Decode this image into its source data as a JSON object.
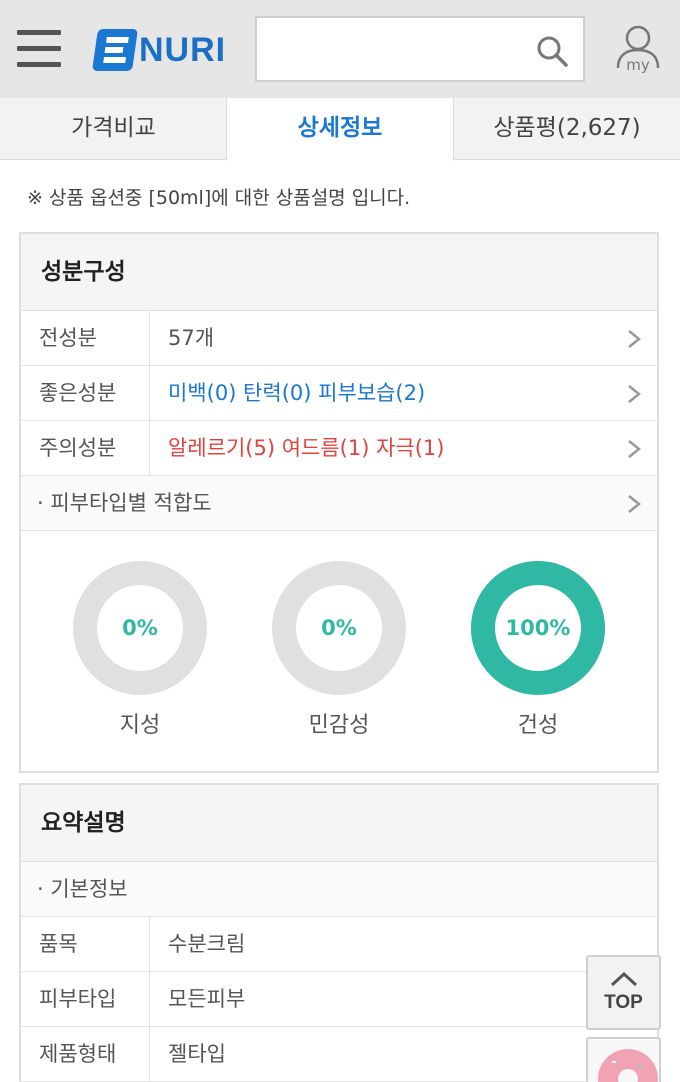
{
  "header": {
    "logo_text": "NURI",
    "search_placeholder": "",
    "my_label": "my"
  },
  "tabs": [
    {
      "label": "가격비교",
      "active": false
    },
    {
      "label": "상세정보",
      "active": true
    },
    {
      "label": "상품평(2,627)",
      "active": false
    }
  ],
  "notice": "※ 상품 옵션중 [50ml]에 대한 상품설명 입니다.",
  "ingredients": {
    "title": "성분구성",
    "rows": [
      {
        "key": "전성분",
        "value": "57개"
      },
      {
        "key": "좋은성분",
        "value": "미백(0) 탄력(0) 피부보습(2)"
      },
      {
        "key": "주의성분",
        "value": "알레르기(5) 여드름(1) 자극(1)"
      }
    ],
    "skin_fit_label": "· 피부타입별 적합도",
    "skin_types": [
      {
        "label": "지성",
        "percent_text": "0%",
        "percent": 0
      },
      {
        "label": "민감성",
        "percent_text": "0%",
        "percent": 0
      },
      {
        "label": "건성",
        "percent_text": "100%",
        "percent": 100
      }
    ]
  },
  "summary": {
    "title": "요약설명",
    "basic_info_label": "· 기본정보",
    "rows": [
      {
        "key": "품목",
        "value": "수분크림"
      },
      {
        "key": "피부타입",
        "value": "모든피부"
      },
      {
        "key": "제품형태",
        "value": "젤타입"
      }
    ]
  },
  "floating": {
    "top_label": "TOP"
  },
  "colors": {
    "accent": "#1a77d2",
    "teal": "#2fb8a4",
    "warning": "#e0433b",
    "ring_empty": "#e0e0e0"
  }
}
